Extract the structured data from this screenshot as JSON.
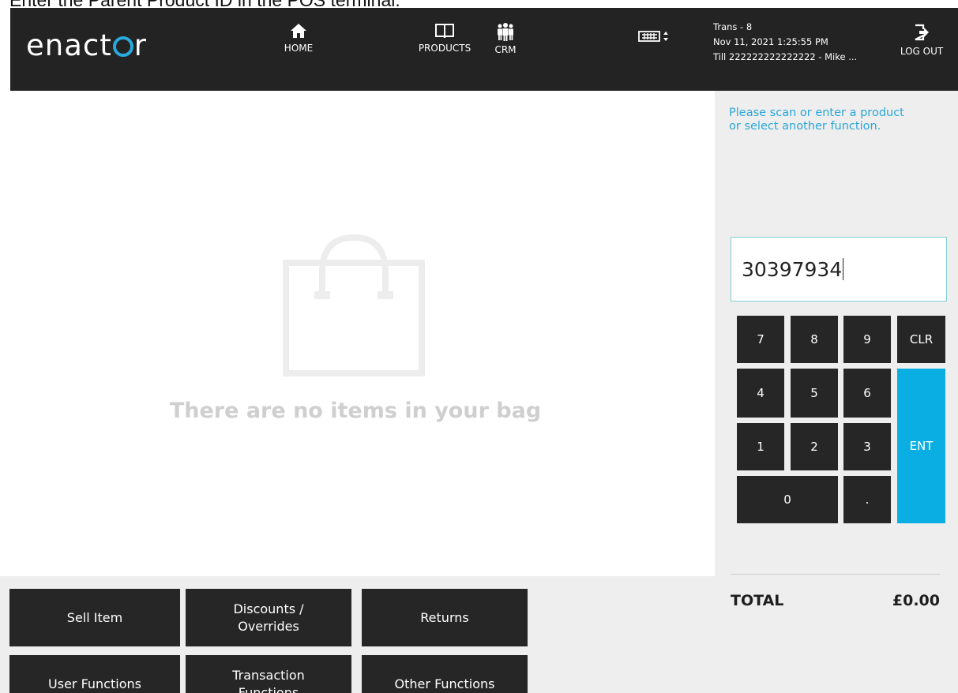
{
  "caption": "Enter the Parent Product ID in the POS terminal.",
  "header": {
    "logo": "enactor",
    "nav": [
      {
        "icon": "home-icon",
        "label": "HOME"
      },
      {
        "icon": "book-icon",
        "label": "PRODUCTS"
      },
      {
        "icon": "people-icon",
        "label": "CRM"
      },
      {
        "icon": "keyboard-toggle-icon",
        "label": ""
      }
    ],
    "trans": "Trans - 8",
    "datetime": "Nov 11, 2021 1:25:55 PM",
    "till": "Till 222222222222222 - Mike ...",
    "logout_label": "LOG OUT"
  },
  "main": {
    "empty_message": "There are no items in your bag"
  },
  "panel": {
    "prompt": "Please scan or enter a product or select another function.",
    "input_value": "30397934",
    "keys": [
      "7",
      "8",
      "9",
      "CLR",
      "4",
      "5",
      "6",
      "ENT",
      "1",
      "2",
      "3",
      "0",
      "."
    ],
    "total_label": "TOTAL",
    "total_value": "£0.00"
  },
  "functions": [
    "Sell Item",
    "Discounts / Overrides",
    "Returns",
    "User Functions",
    "Transaction Functions",
    "Other Functions"
  ],
  "colors": {
    "topbar": "#232323",
    "accent": "#0aaee2",
    "key": "#262626",
    "panel": "#eeeeee"
  }
}
